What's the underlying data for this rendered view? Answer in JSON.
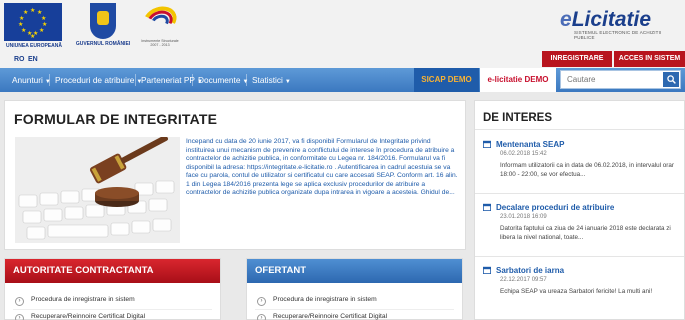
{
  "header": {
    "logos": {
      "eu_caption": "UNIUNEA EUROPEANĂ",
      "gov_caption": "GUVERNUL ROMÂNIEI",
      "struct_caption": "Instrumente Structurale 2007 - 2013"
    },
    "brand": {
      "name": "Licitatie",
      "prefix": "e",
      "tagline": "SISTEMUL ELECTRONIC DE ACHIZITII PUBLICE"
    },
    "languages": [
      "RO",
      "EN"
    ],
    "auth": {
      "register": "INREGISTRARE",
      "login": "ACCES IN SISTEM"
    }
  },
  "nav": {
    "items": [
      "Anunturi",
      "Proceduri de atribuire",
      "Parteneriat PP",
      "Documente",
      "Statistici"
    ],
    "seap_demo": "SICAP DEMO",
    "elicitatie_demo": "e-licitatie DEMO",
    "search_placeholder": "Cautare"
  },
  "main": {
    "title": "FORMULAR DE INTEGRITATE",
    "text": "Incepand cu data de 20 iunie 2017, va fi disponibil Formularul de Integritate privind instituirea unui mecanism de prevenire a conflictului de interese în procedura de atribuire a contractelor de achizitie publica, in conformitate cu Legea nr. 184/2016. Formularul va fi disponibil la adresa: https://integritate.e-licitatie.ro . Autentificarea in cadrul acestuia se va face cu parola, contul de utilizator si certificatul cu care accesati SEAP. Conform art. 16 alin. 1 din Legea 184/2016 prezenta lege se aplica exclusiv procedurilor de atribuire a contractelor de achizitie publica organizate dupa intrarea in vigoare a acesteia. Ghidul de..."
  },
  "sidebar": {
    "title": "DE INTERES",
    "news": [
      {
        "title": "Mentenanta SEAP",
        "date": "06.02.2018 15:42",
        "text": "Informam utilizatorii ca in data de 06.02.2018, in intervalul orar 18:00 - 22:00, se vor efectua..."
      },
      {
        "title": "Decalare proceduri de atribuire",
        "date": "23.01.2018 16:09",
        "text": "Datorita faptului ca ziua de 24 ianuarie 2018 este declarata zi libera la nivel national, toate..."
      },
      {
        "title": "Sarbatori de iarna",
        "date": "22.12.2017 09:57",
        "text": "Echipa SEAP va ureaza Sarbatori fericite! La multi ani!"
      }
    ]
  },
  "boxes": {
    "authority": {
      "title": "AUTORITATE CONTRACTANTA",
      "items": [
        "Procedura de inregistrare in sistem",
        "Recuperare/Reinnoire Certificat Digital"
      ]
    },
    "bidder": {
      "title": "OFERTANT",
      "items": [
        "Procedura de inregistrare in sistem",
        "Recuperare/Reinnoire Certificat Digital"
      ]
    }
  },
  "colors": {
    "brand_blue": "#1f5caa",
    "accent_red": "#b8141e",
    "nav_blue": "#3b78c0",
    "demo_orange": "#f9b233"
  },
  "icons": [
    "search-icon",
    "calendar-icon",
    "chevron-right-icon",
    "caret-down-icon"
  ]
}
